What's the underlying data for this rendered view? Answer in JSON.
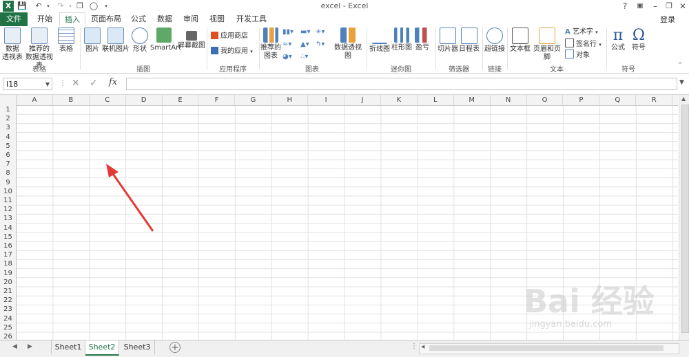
{
  "title_bar": {
    "title": "excel - Excel",
    "quick_access": [
      "excel-logo-icon",
      "save-icon",
      "undo-icon",
      "redo-icon",
      "copy-icon",
      "print-preview-icon",
      "customize-icon"
    ],
    "help": "?",
    "controls": [
      "ribbon-display-icon",
      "minimize-icon",
      "restore-icon",
      "close-icon"
    ]
  },
  "tabs": [
    "文件",
    "开始",
    "插入",
    "页面布局",
    "公式",
    "数据",
    "审阅",
    "视图",
    "开发工具"
  ],
  "active_tab": "插入",
  "login": "登录",
  "ribbon": {
    "groups": {
      "tables": "表格",
      "illustrations": "插图",
      "apps": "应用程序",
      "charts": "图表",
      "sparklines": "迷你图",
      "filters": "筛选器",
      "links": "链接",
      "text": "文本",
      "symbols": "符号"
    },
    "buttons": {
      "pivot_line1": "数据",
      "pivot_line2": "透视表",
      "rec_pivot_line1": "推荐的",
      "rec_pivot_line2": "数据透视表",
      "table": "表格",
      "picture": "图片",
      "online_picture": "联机图片",
      "shapes": "形状",
      "smartart": "SmartArt",
      "screenshot": "屏幕截图",
      "app_store": "应用商店",
      "my_apps": "我的应用",
      "rec_charts_line1": "推荐的",
      "rec_charts_line2": "图表",
      "pivot_chart": "数据透视图",
      "line_spark": "折线图",
      "column_spark": "柱形图",
      "winloss": "盈亏",
      "slicer": "切片器",
      "timeline": "日程表",
      "hyperlink": "超链接",
      "textbox": "文本框",
      "header_footer": "页眉和页脚",
      "wordart": "艺术字",
      "signature": "签名行",
      "object": "对象",
      "equation": "公式",
      "symbol": "符号"
    }
  },
  "formula_bar": {
    "name_box": "I18",
    "fx": "fx",
    "content": ""
  },
  "columns": [
    "A",
    "B",
    "C",
    "D",
    "E",
    "F",
    "G",
    "H",
    "I",
    "J",
    "K",
    "L",
    "M",
    "N",
    "O",
    "P",
    "Q",
    "R"
  ],
  "rows": [
    "1",
    "2",
    "3",
    "4",
    "5",
    "6",
    "7",
    "8",
    "9",
    "10",
    "11",
    "12",
    "13",
    "14",
    "15",
    "16",
    "17",
    "18",
    "19",
    "20",
    "21",
    "22",
    "23",
    "24",
    "25",
    "26"
  ],
  "sheets": [
    "Sheet1",
    "Sheet2",
    "Sheet3"
  ],
  "active_sheet": "Sheet2",
  "watermark": {
    "main": "Bai 经验",
    "url": "jingyan.baidu.com"
  },
  "colors": {
    "accent": "#217346",
    "arrow": "#e53935"
  }
}
